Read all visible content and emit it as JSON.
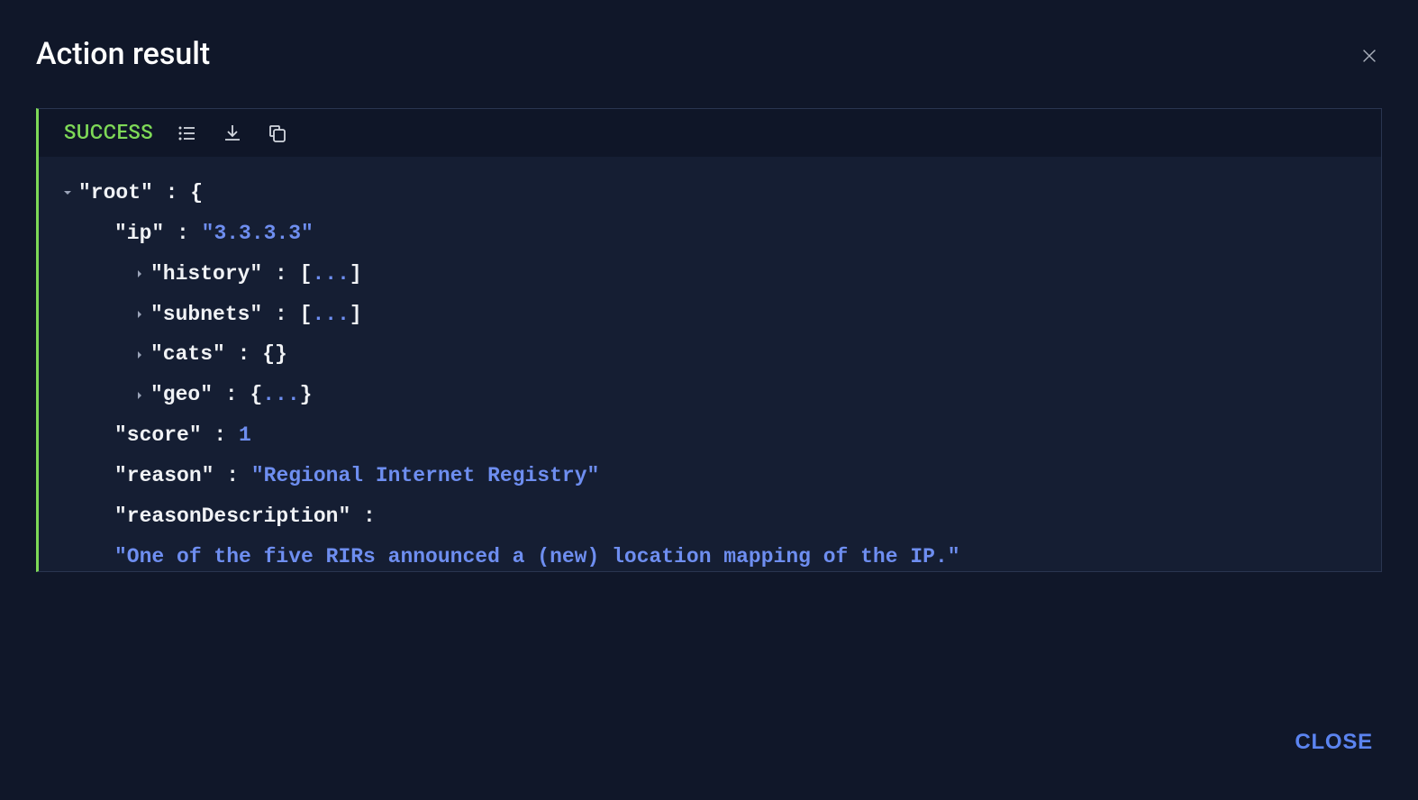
{
  "header": {
    "title": "Action result"
  },
  "panel": {
    "status": "SUCCESS"
  },
  "json": {
    "root_key": "\"root\"",
    "root_brace": "{",
    "ip_key": "\"ip\"",
    "ip_val": "\"3.3.3.3\"",
    "history_key": "\"history\"",
    "history_open": "[",
    "history_ellipsis": "...",
    "history_close": "]",
    "subnets_key": "\"subnets\"",
    "subnets_open": "[",
    "subnets_ellipsis": "...",
    "subnets_close": "]",
    "cats_key": "\"cats\"",
    "cats_braces": "{}",
    "geo_key": "\"geo\"",
    "geo_open": "{",
    "geo_ellipsis": "...",
    "geo_close": "}",
    "score_key": "\"score\"",
    "score_val": "1",
    "reason_key": "\"reason\"",
    "reason_val": "\"Regional Internet Registry\"",
    "reasonDesc_key": "\"reasonDescription\"",
    "reasonDesc_val": "\"One of the five RIRs announced a (new) location mapping of the IP.\""
  },
  "footer": {
    "close": "CLOSE"
  }
}
